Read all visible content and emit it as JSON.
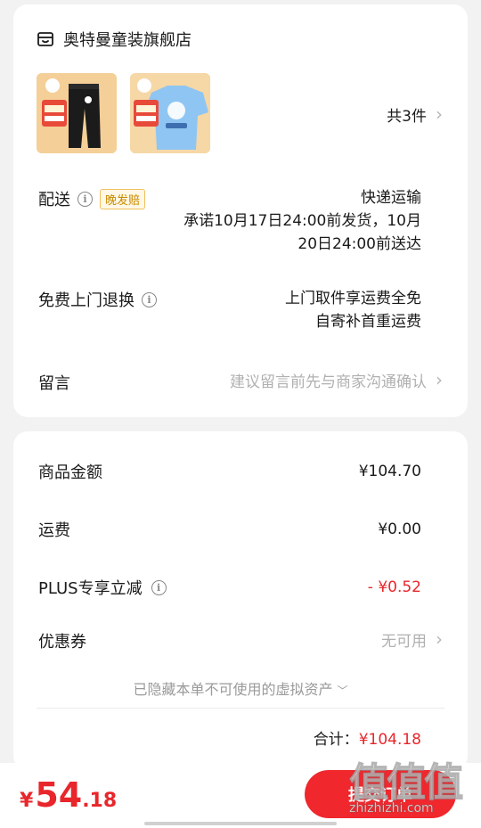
{
  "order": {
    "store_name": "奥特曼童装旗舰店",
    "store_icon": "store-icon",
    "item_count": "共3件",
    "delivery": {
      "label": "配送",
      "tag": "晚发赔",
      "method": "快递运输",
      "promise_line1": "承诺10月17日24:00前发货，10月",
      "promise_line2": "20日24:00前送达"
    },
    "return": {
      "label": "免费上门退换",
      "line1": "上门取件享运费全免",
      "line2": "自寄补首重运费"
    },
    "note": {
      "label": "留言",
      "placeholder": "建议留言前先与商家沟通确认"
    }
  },
  "price": {
    "goods_label": "商品金额",
    "goods_value": "¥104.70",
    "shipping_label": "运费",
    "shipping_value": "¥0.00",
    "plus_label": "PLUS专享立减",
    "plus_value": "- ¥0.52",
    "coupon_label": "优惠券",
    "coupon_value": "无可用",
    "hidden_note": "已隐藏本单不可使用的虚拟资产",
    "total_label": "合计：",
    "total_value": "¥104.18"
  },
  "bottom": {
    "currency": "¥",
    "pay_int": "54",
    "pay_dec": ".18",
    "submit_label": "提交订单"
  },
  "watermark": {
    "big": "值值值",
    "small": "zhizhizhi.com"
  },
  "colors": {
    "accent_red": "#e8262b",
    "tag_border": "#f0c060"
  }
}
